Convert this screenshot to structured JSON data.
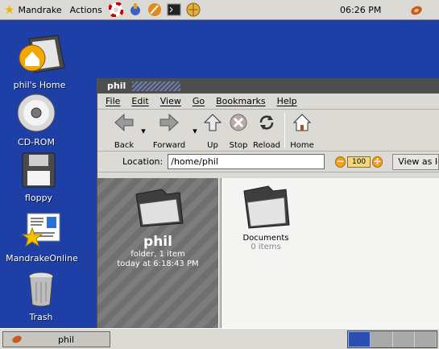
{
  "top_panel": {
    "menu_main": "Mandrake",
    "menu_actions": "Actions",
    "clock": "06:26 PM"
  },
  "desktop": {
    "icons": [
      {
        "label": "phil's Home"
      },
      {
        "label": "CD-ROM"
      },
      {
        "label": "floppy"
      },
      {
        "label": "MandrakeOnline"
      },
      {
        "label": "Trash"
      }
    ]
  },
  "window": {
    "title": "phil",
    "menu": [
      "File",
      "Edit",
      "View",
      "Go",
      "Bookmarks",
      "Help"
    ],
    "toolbar": {
      "back": "Back",
      "forward": "Forward",
      "up": "Up",
      "stop": "Stop",
      "reload": "Reload",
      "home": "Home"
    },
    "location": {
      "label": "Location:",
      "value": "/home/phil",
      "zoom": "100",
      "view_as": "View as Ic"
    },
    "sidepane": {
      "name": "phil",
      "info_line1": "folder, 1 item",
      "info_line2": "today at 6:18:43 PM"
    },
    "items": [
      {
        "name": "Documents",
        "info": "0 items"
      }
    ]
  },
  "bottom_panel": {
    "task": "phil",
    "workspaces": 4,
    "active_workspace": 1
  }
}
